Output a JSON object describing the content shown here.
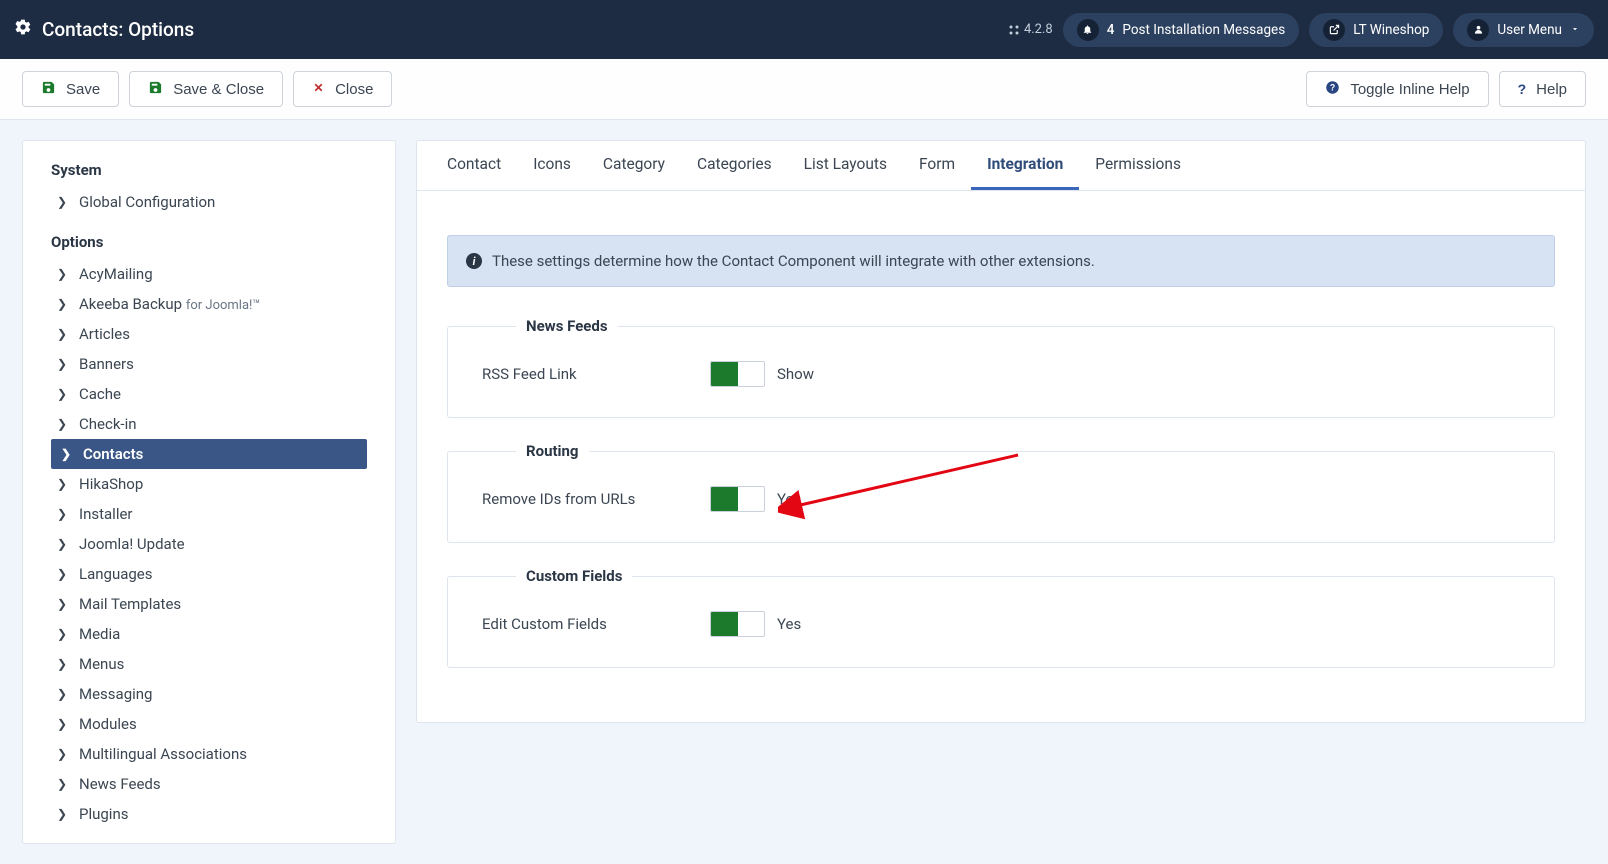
{
  "header": {
    "title": "Contacts: Options",
    "version": "4.2.8",
    "messages_count": "4",
    "messages_label": "Post Installation Messages",
    "site_name": "LT Wineshop",
    "user_menu": "User Menu"
  },
  "toolbar": {
    "save": "Save",
    "save_close": "Save & Close",
    "close": "Close",
    "toggle_help": "Toggle Inline Help",
    "help": "Help"
  },
  "sidebar": {
    "system_label": "System",
    "global_config": "Global Configuration",
    "options_label": "Options",
    "items": [
      "AcyMailing",
      "Akeeba Backup",
      "Articles",
      "Banners",
      "Cache",
      "Check-in",
      "Contacts",
      "HikaShop",
      "Installer",
      "Joomla! Update",
      "Languages",
      "Mail Templates",
      "Media",
      "Menus",
      "Messaging",
      "Modules",
      "Multilingual Associations",
      "News Feeds",
      "Plugins"
    ],
    "akeeba_suffix": "for Joomla!™"
  },
  "tabs": [
    "Contact",
    "Icons",
    "Category",
    "Categories",
    "List Layouts",
    "Form",
    "Integration",
    "Permissions"
  ],
  "panel": {
    "alert": "These settings determine how the Contact Component will integrate with other extensions.",
    "groups": {
      "news_feeds": {
        "legend": "News Feeds",
        "rss_label": "RSS Feed Link",
        "rss_value": "Show"
      },
      "routing": {
        "legend": "Routing",
        "remove_ids_label": "Remove IDs from URLs",
        "remove_ids_value": "Yes"
      },
      "custom_fields": {
        "legend": "Custom Fields",
        "edit_label": "Edit Custom Fields",
        "edit_value": "Yes"
      }
    }
  }
}
